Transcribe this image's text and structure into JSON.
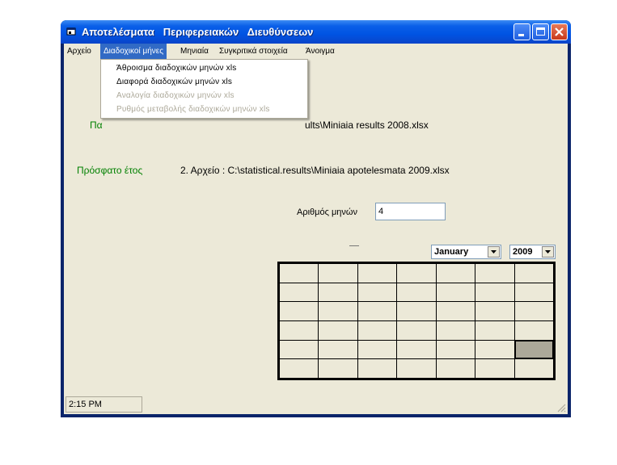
{
  "window": {
    "title": "Αποτελέσματα   Περιφερειακών   Διευθύνσεων"
  },
  "menu": {
    "items": [
      "Αρχείο",
      "Διαδοχικοί μήνες",
      "Μηνιαία",
      "Συγκριτικά στοιχεία",
      "Άνοιγμα"
    ],
    "active_index": 1
  },
  "dropdown": {
    "items": [
      {
        "label": "Άθροισμα  διαδοχικών  μηνών  xls",
        "enabled": true
      },
      {
        "label": "Διαφορά  διαδοχικών  μηνών  xls",
        "enabled": true
      },
      {
        "label": "Αναλογία  διαδοχικών  μηνών  xls",
        "enabled": false
      },
      {
        "label": "Ρυθμός  μεταβολής  διαδοχικών   μηνών  xls",
        "enabled": false
      }
    ]
  },
  "main": {
    "previous_label_fragment": "Πα",
    "file1_fragment": "ults\\Miniaia results  2008.xlsx",
    "recent_year_label": "Πρόσφατο   έτος",
    "file2": "2. Αρχείο : C:\\statistical.results\\Miniaia apotelesmata 2009.xlsx",
    "months_label": "Αριθμός  μηνών",
    "months_value": "4",
    "month_select": "January",
    "year_select": "2009"
  },
  "status": {
    "time": "2:15 PM"
  },
  "colors": {
    "green_text": "#008000",
    "menu_highlight": "#316ac5",
    "window_bg": "#ece9d8"
  }
}
